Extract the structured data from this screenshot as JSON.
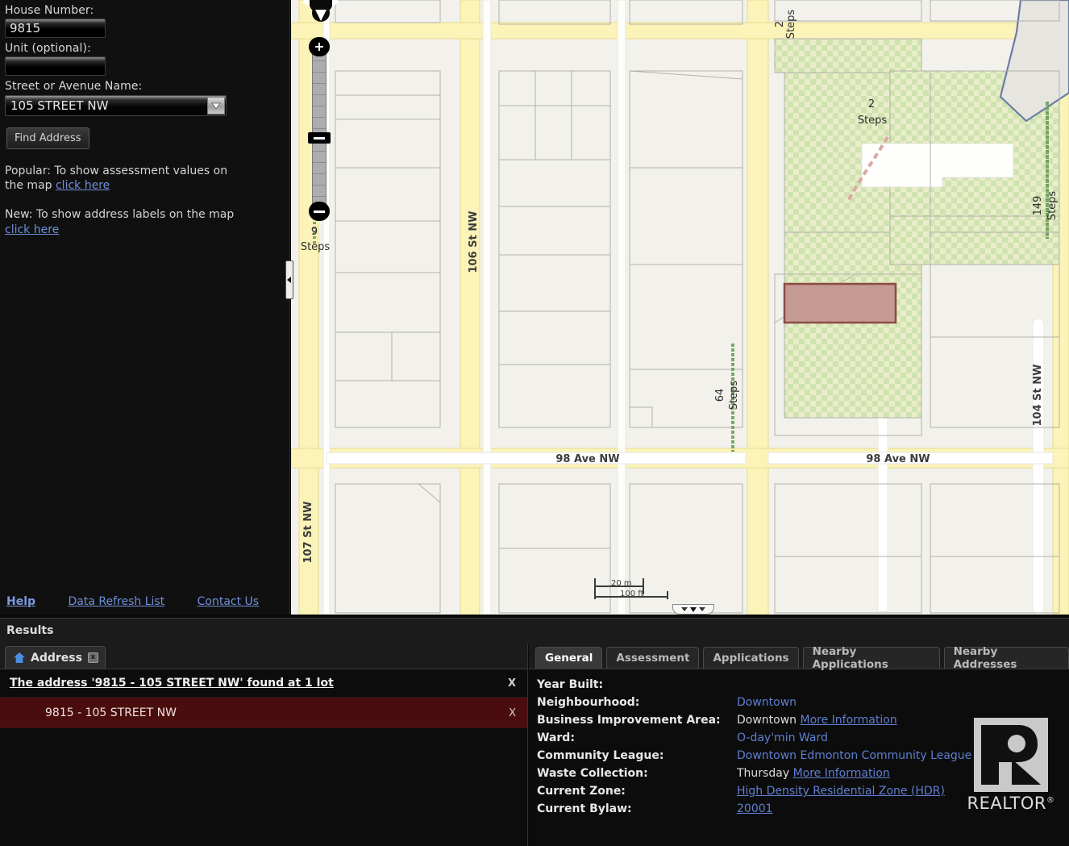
{
  "sidebar": {
    "house_number_label": "House Number:",
    "house_number_value": "9815",
    "unit_label": "Unit (optional):",
    "unit_value": "",
    "unit_placeholder": "",
    "street_label": "Street or Avenue Name:",
    "street_value": "105 STREET NW",
    "find_button": "Find Address",
    "popular_text": "Popular: To show assessment values on the map",
    "popular_link": "click here",
    "new_text": "New: To show address labels on the map",
    "new_link": "click here",
    "footer_links": [
      {
        "label": "Help"
      },
      {
        "label": "Data Refresh List"
      },
      {
        "label": "Contact Us"
      }
    ]
  },
  "map": {
    "scale_metric": "20 m",
    "scale_imperial": "100 ft",
    "street_labels": [
      {
        "text": "106 St NW"
      },
      {
        "text": "107 St NW"
      },
      {
        "text": "104 St NW"
      },
      {
        "text": "98 Ave NW"
      },
      {
        "text": "98 Ave NW"
      }
    ],
    "step_labels": [
      {
        "count": "2",
        "text": "Steps"
      },
      {
        "count": "2",
        "text": "Steps"
      },
      {
        "count": "9",
        "text": "Steps"
      },
      {
        "count": "64",
        "text": "Steps"
      },
      {
        "count": "149",
        "text": "Steps"
      }
    ],
    "colors": {
      "background": "#f2f1ec",
      "road_yellow": "#f7f0ae",
      "road_white": "#ffffff",
      "parcel_outline": "#a9a9a2",
      "green_space": "#d4e6b6",
      "highlight_fill": "#c49a93",
      "highlight_stroke": "#8a4d45"
    }
  },
  "results": {
    "header": "Results",
    "tab_label": "Address",
    "tab_close": "x",
    "summary": "The address '9815 - 105 STREET NW' found at 1 lot",
    "summary_close": "X",
    "rows": [
      {
        "label": "9815 - 105 STREET NW",
        "close": "X"
      }
    ]
  },
  "detail": {
    "tabs": [
      {
        "label": "General",
        "active": true
      },
      {
        "label": "Assessment",
        "active": false
      },
      {
        "label": "Applications",
        "active": false
      },
      {
        "label": "Nearby Applications",
        "active": false
      },
      {
        "label": "Nearby Addresses",
        "active": false
      }
    ],
    "fields": [
      {
        "key": "Year Built:",
        "value": "",
        "link": "",
        "link2": ""
      },
      {
        "key": "Neighbourhood:",
        "value": "",
        "link": "Downtown",
        "link2": ""
      },
      {
        "key": "Business Improvement Area:",
        "value": "Downtown ",
        "link": "",
        "link2": "More Information"
      },
      {
        "key": "Ward:",
        "value": "",
        "link": "O-day'min Ward",
        "link2": ""
      },
      {
        "key": "Community League:",
        "value": "",
        "link": "Downtown Edmonton Community League",
        "link2": ""
      },
      {
        "key": "Waste Collection:",
        "value": "Thursday ",
        "link": "",
        "link2": "More Information"
      },
      {
        "key": "Current Zone:",
        "value": "",
        "link": "",
        "link2": "High Density Residential Zone (HDR)"
      },
      {
        "key": "Current Bylaw:",
        "value": "",
        "link": "",
        "link2": "20001"
      }
    ],
    "logo_word": "REALTOR",
    "logo_sup": "®"
  }
}
